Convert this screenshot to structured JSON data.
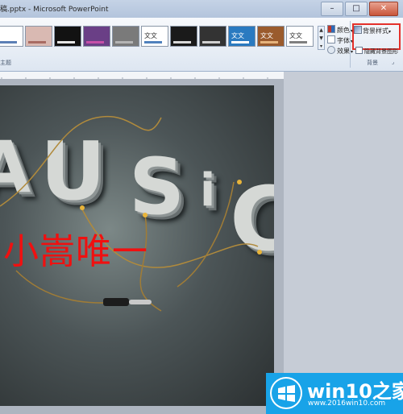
{
  "window": {
    "title": "稿.pptx - Microsoft PowerPoint",
    "minimize_label": "–",
    "maximize_label": "□",
    "close_label": "✕"
  },
  "ribbon": {
    "theme_thumbnails": [
      {
        "label": "",
        "bg": "#ffffff",
        "bar": "#5b7fb5",
        "fg": "#333"
      },
      {
        "label": "",
        "bg": "#d9b9b2",
        "bar": "#a86b62",
        "fg": "#333"
      },
      {
        "label": "",
        "bg": "#121212",
        "bar": "#e6e6e6",
        "fg": "#fff"
      },
      {
        "label": "",
        "bg": "#6a3f86",
        "bar": "#c64fa8",
        "fg": "#fff"
      },
      {
        "label": "",
        "bg": "#7a7a7a",
        "bar": "#b4b4b4",
        "fg": "#fff"
      },
      {
        "label": "文文",
        "bg": "#ffffff",
        "bar": "#4f81bd",
        "fg": "#333"
      },
      {
        "label": "",
        "bg": "#1a1a1a",
        "bar": "#d8d8d8",
        "fg": "#fff"
      },
      {
        "label": "",
        "bg": "#333333",
        "bar": "#cfcfcf",
        "fg": "#fff"
      },
      {
        "label": "文文",
        "bg": "#2a7ac0",
        "bar": "#ffffff",
        "fg": "#fff"
      },
      {
        "label": "文文",
        "bg": "#9a5b2d",
        "bar": "#e6b37c",
        "fg": "#fff"
      },
      {
        "label": "文文",
        "bg": "#ffffff",
        "bar": "#7f7f7f",
        "fg": "#333"
      }
    ],
    "colors_label": "颜色",
    "fonts_label": "字体",
    "effects_label": "效果",
    "background_styles_label": "背景样式",
    "hide_background_label": "隐藏背景图形",
    "themes_group_label": "主题",
    "background_group_label": "背景"
  },
  "slide": {
    "title_text": "MUSIC",
    "caption": "小嵩唯一"
  },
  "watermark": {
    "brand": "win10之家",
    "url": "www.2016win10.com"
  },
  "colors": {
    "highlight": "#e4312b",
    "caption": "#f01010",
    "logo": "#18a3e8"
  }
}
